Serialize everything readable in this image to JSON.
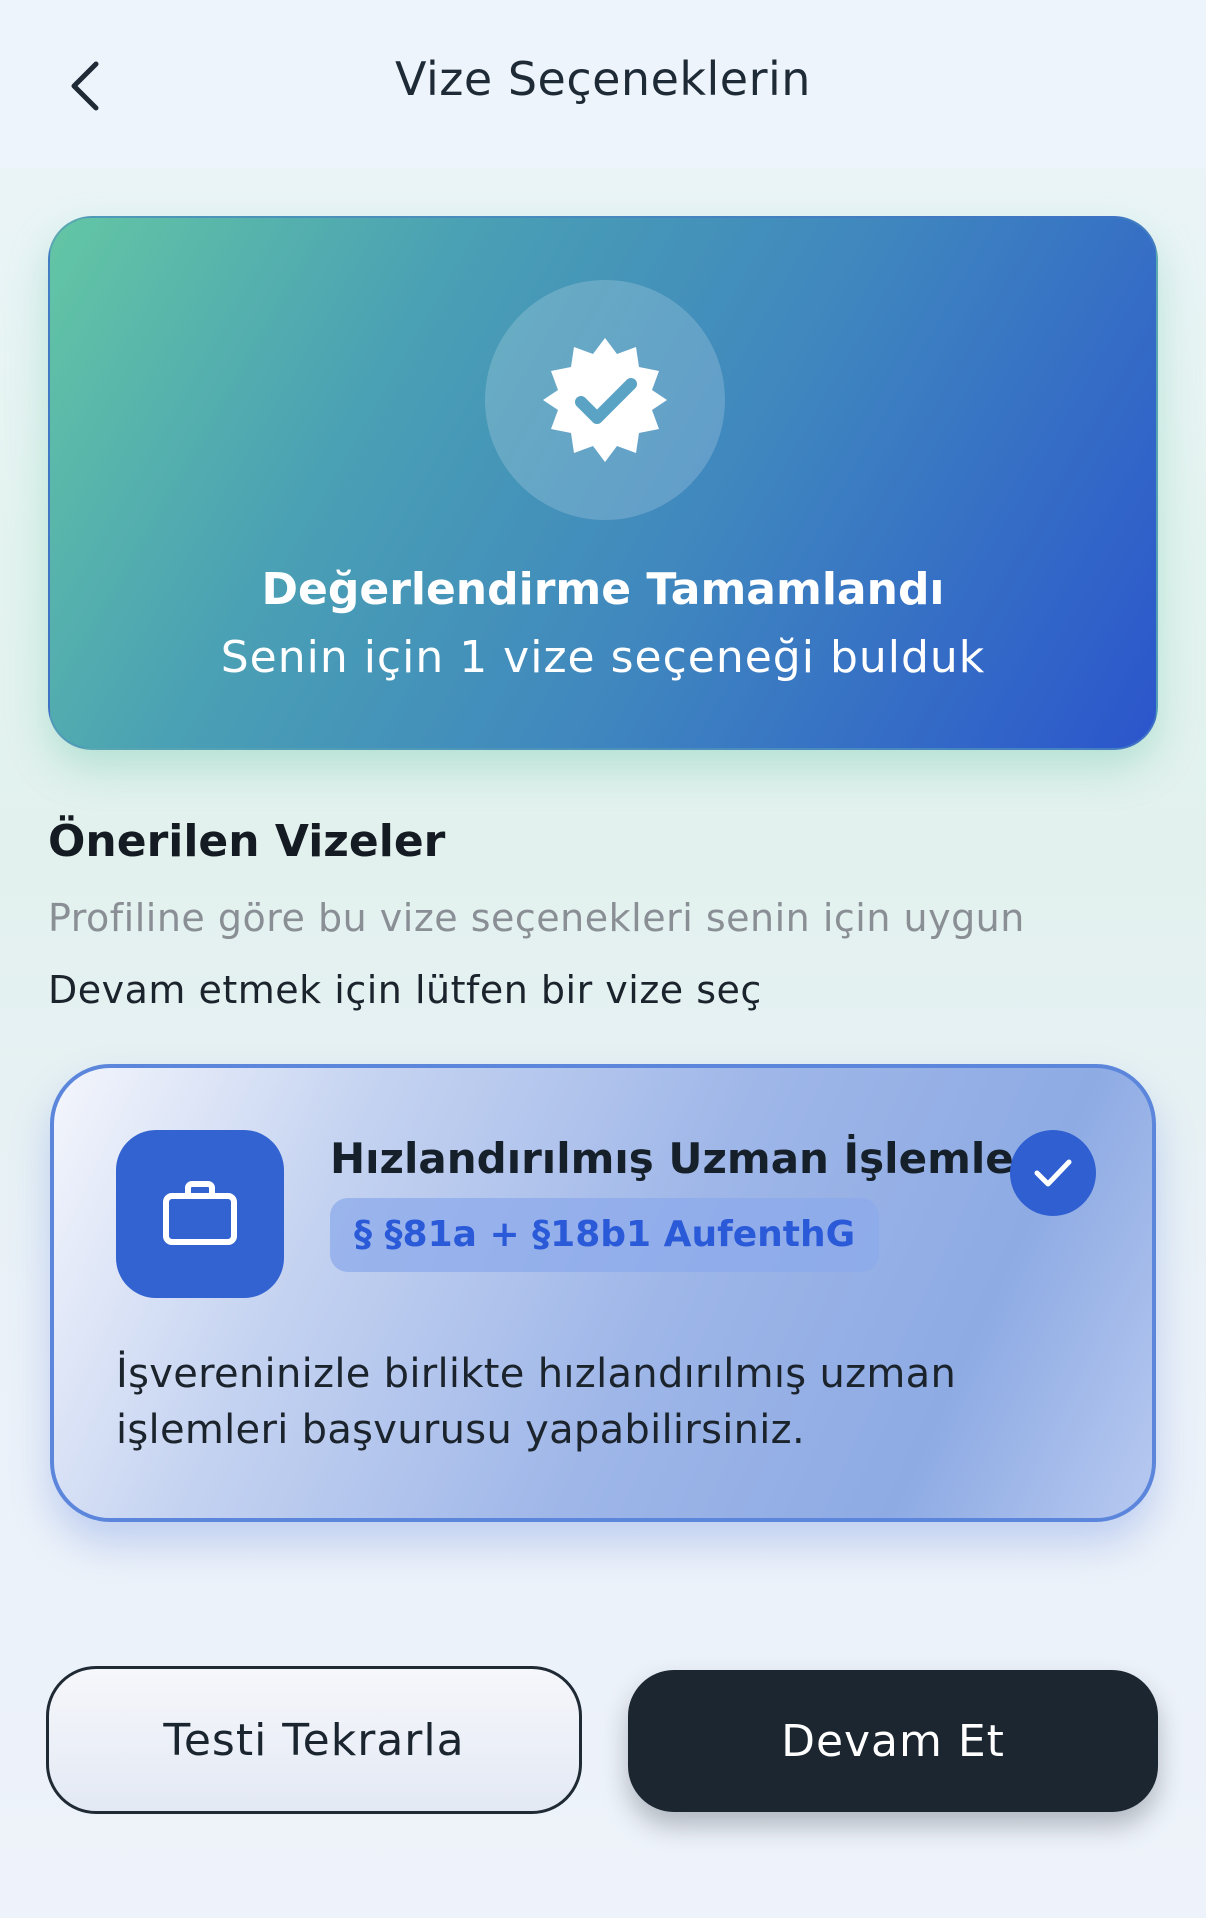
{
  "header": {
    "title": "Vize Seçeneklerin",
    "back_icon": "chevron-left-icon"
  },
  "hero": {
    "icon": "verified-badge-icon",
    "title": "Değerlendirme Tamamlandı",
    "subtitle": "Senin için 1 vize seçeneği bulduk"
  },
  "recommended": {
    "title": "Önerilen Vizeler",
    "subtitle": "Profiline göre bu vize seçenekleri senin için uygun",
    "hint": "Devam etmek için lütfen bir vize seç",
    "visas": [
      {
        "icon": "briefcase-icon",
        "title": "Hızlandırılmış Uzman İşlemleri",
        "tag": "§ §81a + §18b1 AufenthG",
        "description": "İşvereninizle birlikte hızlandırılmış uzman işlemleri başvurusu yapabilirsiniz.",
        "selected": true
      }
    ]
  },
  "actions": {
    "retry_label": "Testi Tekrarla",
    "continue_label": "Devam Et"
  },
  "colors": {
    "accent": "#2f5fd0",
    "dark_button": "#1b2631",
    "hero_gradient_start": "#63c6a4",
    "hero_gradient_end": "#2b55cc"
  }
}
